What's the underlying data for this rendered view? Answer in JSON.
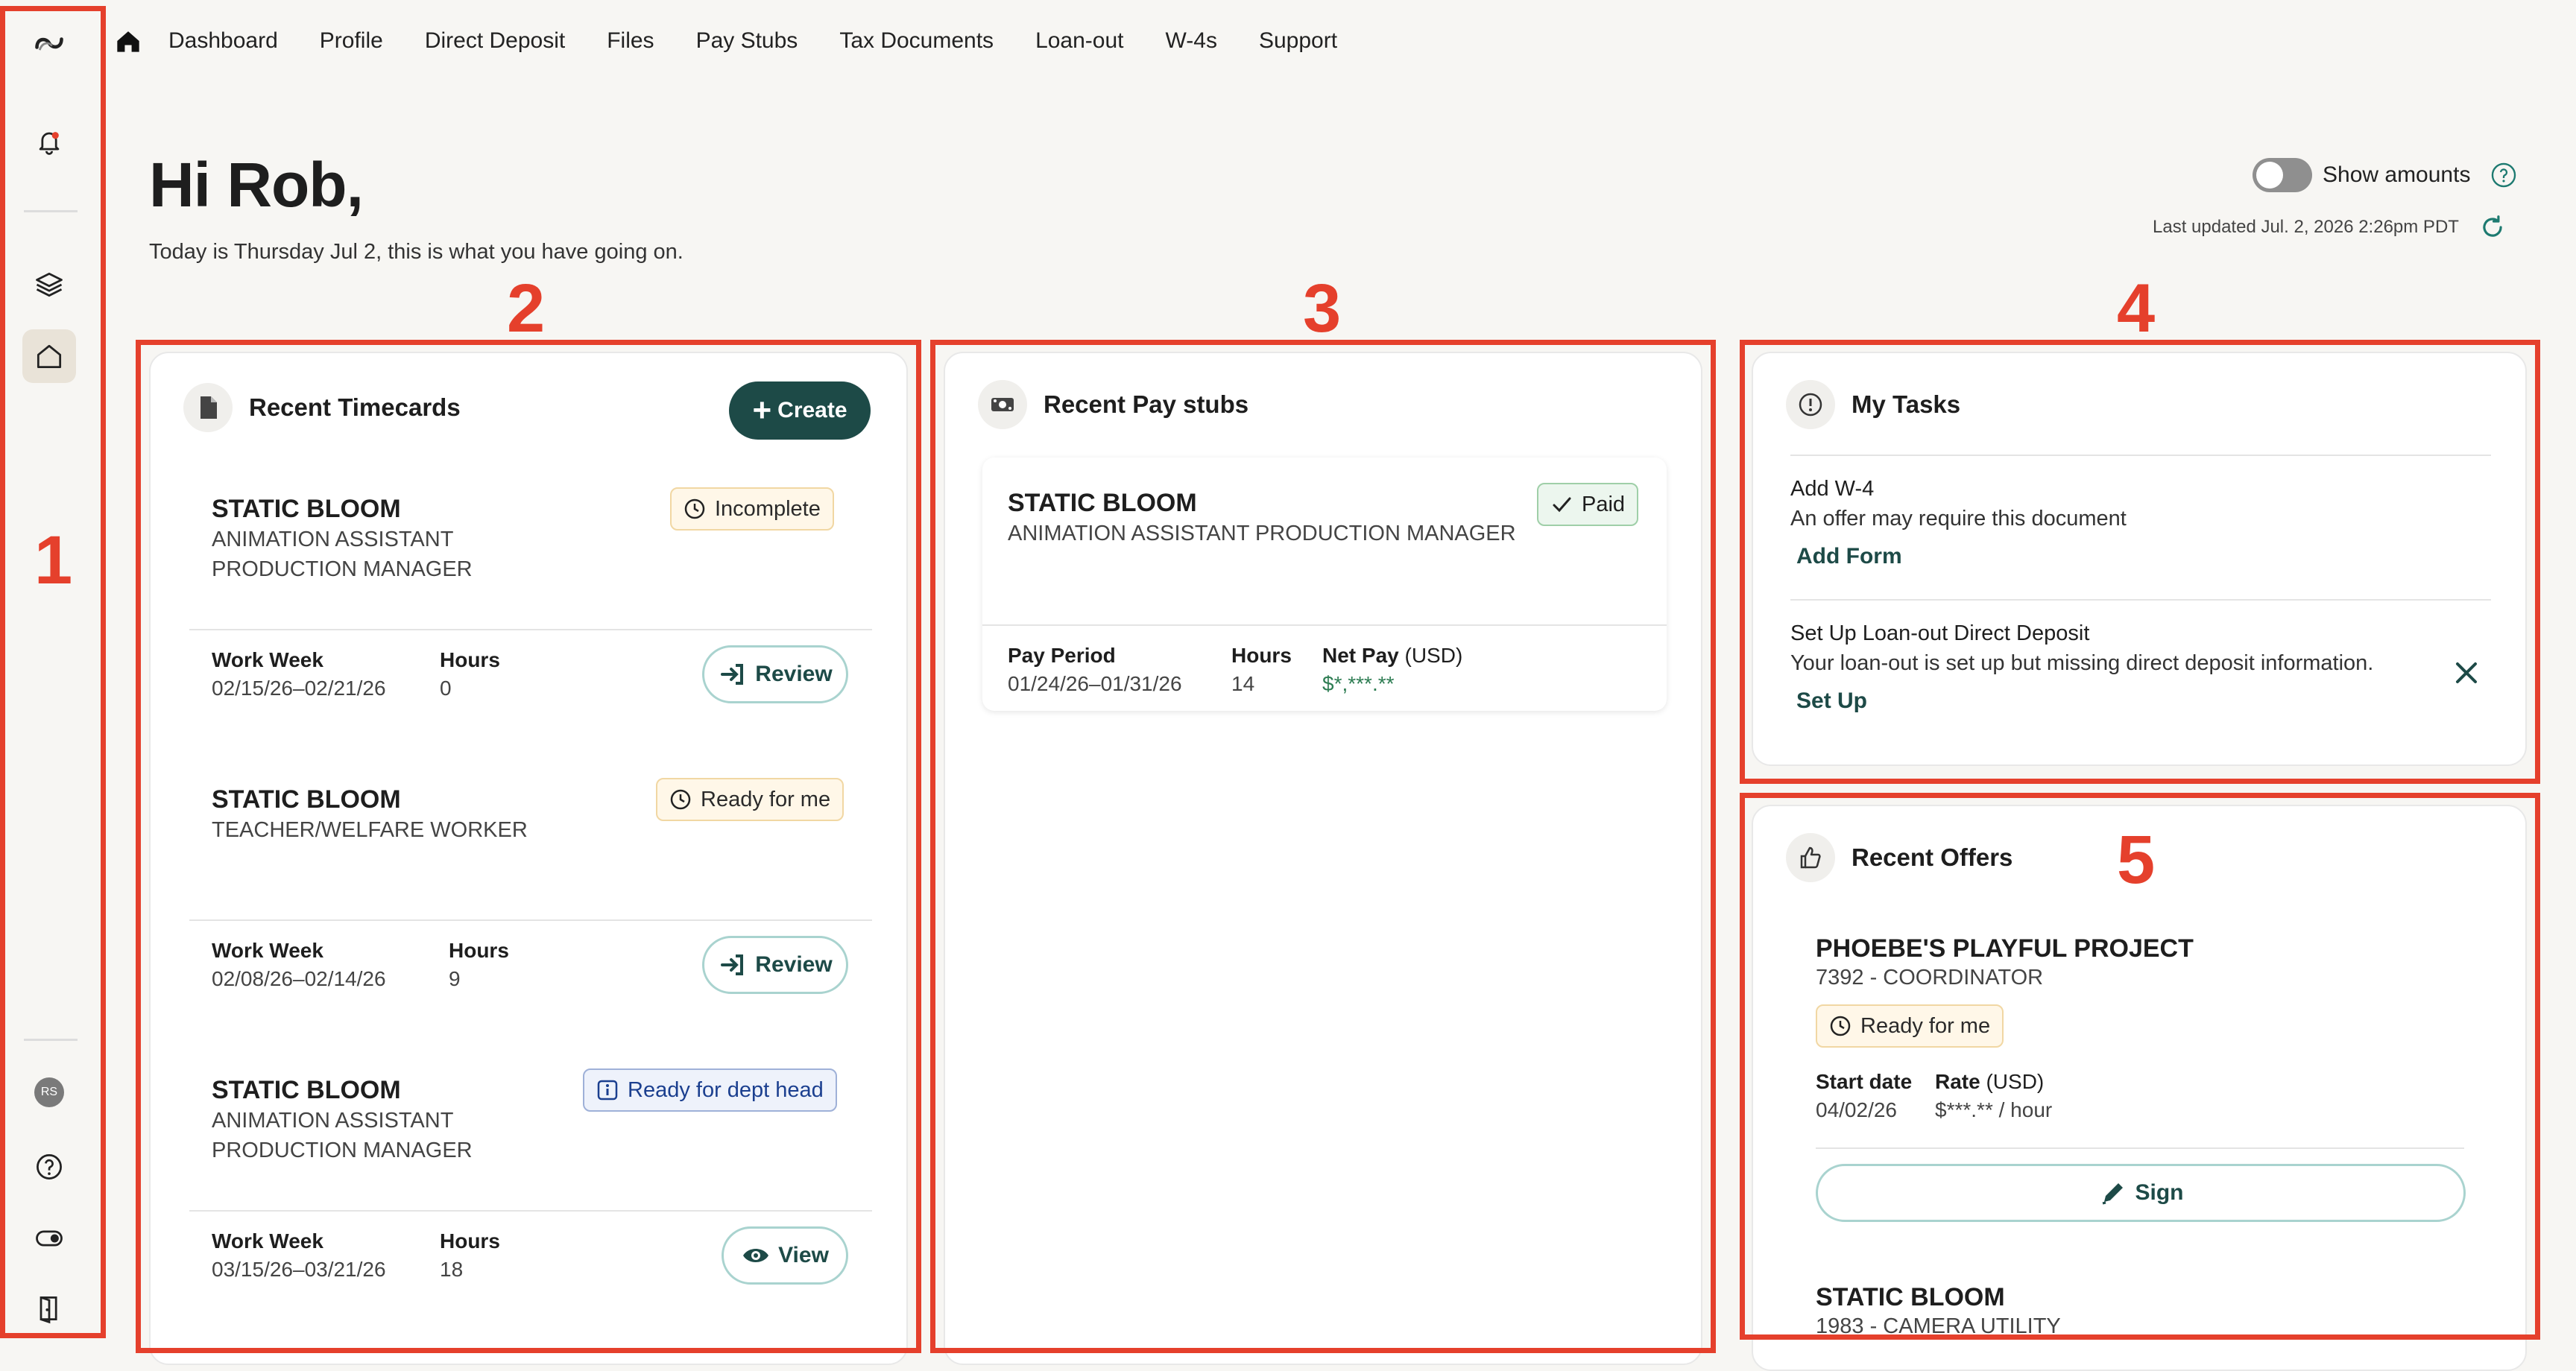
{
  "nav": {
    "items": [
      "Dashboard",
      "Profile",
      "Direct Deposit",
      "Files",
      "Pay Stubs",
      "Tax Documents",
      "Loan-out",
      "W-4s",
      "Support"
    ]
  },
  "rail": {
    "avatar_initials": "RS"
  },
  "header": {
    "greeting": "Hi Rob,",
    "subtitle": "Today is Thursday Jul 2, this is what you have going on.",
    "show_amounts_label": "Show amounts",
    "last_updated": "Last updated Jul. 2, 2026 2:26pm PDT"
  },
  "annotations": [
    "1",
    "2",
    "3",
    "4",
    "5"
  ],
  "timecards": {
    "title": "Recent Timecards",
    "create_label": "Create",
    "labels": {
      "work_week": "Work Week",
      "hours": "Hours"
    },
    "items": [
      {
        "project": "STATIC BLOOM",
        "role_line1": "ANIMATION ASSISTANT",
        "role_line2": "PRODUCTION MANAGER",
        "status": "Incomplete",
        "week": "02/15/26–02/21/26",
        "hours": "0",
        "action": "Review"
      },
      {
        "project": "STATIC BLOOM",
        "role_line1": "TEACHER/WELFARE WORKER",
        "role_line2": "",
        "status": "Ready for me",
        "week": "02/08/26–02/14/26",
        "hours": "9",
        "action": "Review"
      },
      {
        "project": "STATIC BLOOM",
        "role_line1": "ANIMATION ASSISTANT",
        "role_line2": "PRODUCTION MANAGER",
        "status": "Ready for dept head",
        "week": "03/15/26–03/21/26",
        "hours": "18",
        "action": "View"
      }
    ]
  },
  "paystubs": {
    "title": "Recent Pay stubs",
    "item": {
      "project": "STATIC BLOOM",
      "role": "ANIMATION ASSISTANT PRODUCTION MANAGER",
      "status": "Paid",
      "pay_period_label": "Pay Period",
      "hours_label": "Hours",
      "net_pay_label": "Net Pay",
      "net_pay_unit": "(USD)",
      "pay_period": "01/24/26–01/31/26",
      "hours": "14",
      "net_pay": "$*,***.**"
    }
  },
  "tasks": {
    "title": "My Tasks",
    "items": [
      {
        "title": "Add W-4",
        "desc": "An offer may require this document",
        "action": "Add Form"
      },
      {
        "title": "Set Up Loan-out Direct Deposit",
        "desc": "Your loan-out is set up but missing direct deposit information.",
        "action": "Set Up"
      }
    ]
  },
  "offers": {
    "title": "Recent Offers",
    "items": [
      {
        "project": "PHOEBE'S PLAYFUL PROJECT",
        "role": "7392 - COORDINATOR",
        "status": "Ready for me",
        "start_label": "Start date",
        "rate_label": "Rate",
        "rate_unit": "(USD)",
        "start": "04/02/26",
        "rate": "$***.** / hour",
        "action": "Sign"
      },
      {
        "project": "STATIC BLOOM",
        "role": "1983 - CAMERA UTILITY"
      }
    ]
  },
  "colors": {
    "accent": "#1d4a47",
    "annotation": "#e5402c"
  }
}
